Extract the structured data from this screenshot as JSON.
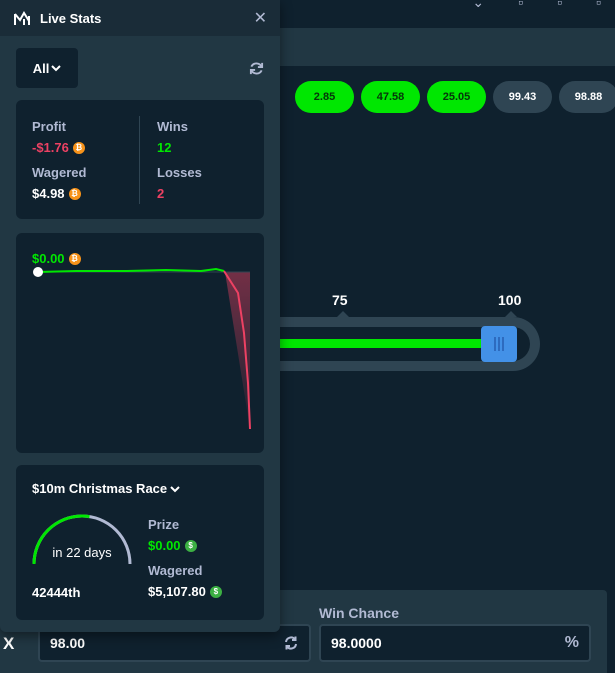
{
  "history": [
    {
      "value": "2.85",
      "status": "win"
    },
    {
      "value": "47.58",
      "status": "win"
    },
    {
      "value": "25.05",
      "status": "win"
    },
    {
      "value": "99.43",
      "status": "loss"
    },
    {
      "value": "98.88",
      "status": "loss"
    }
  ],
  "slider": {
    "ticks": [
      {
        "label": "75"
      },
      {
        "label": "100"
      }
    ],
    "value": 98
  },
  "bet": {
    "multiplier_suffix": "X",
    "roll_over_value": "98.00",
    "win_chance_label": "Win Chance",
    "win_chance_value": "98.0000",
    "win_chance_suffix": "%"
  },
  "live_stats": {
    "title": "Live Stats",
    "filter": "All",
    "profit_label": "Profit",
    "profit_value": "-$1.76",
    "wagered_label": "Wagered",
    "wagered_value": "$4.98",
    "wins_label": "Wins",
    "wins_value": "12",
    "losses_label": "Losses",
    "losses_value": "2",
    "chart_value": "$0.00"
  },
  "race": {
    "title": "$10m Christmas Race",
    "time_left": "in 22 days",
    "rank": "42444th",
    "prize_label": "Prize",
    "prize_value": "$0.00",
    "wagered_label": "Wagered",
    "wagered_value": "$5,107.80",
    "progress": 0.55
  },
  "colors": {
    "win": "#00e701",
    "loss": "#ed4163",
    "panel": "#213743",
    "card": "#0f212e",
    "handle": "#4391e7"
  }
}
